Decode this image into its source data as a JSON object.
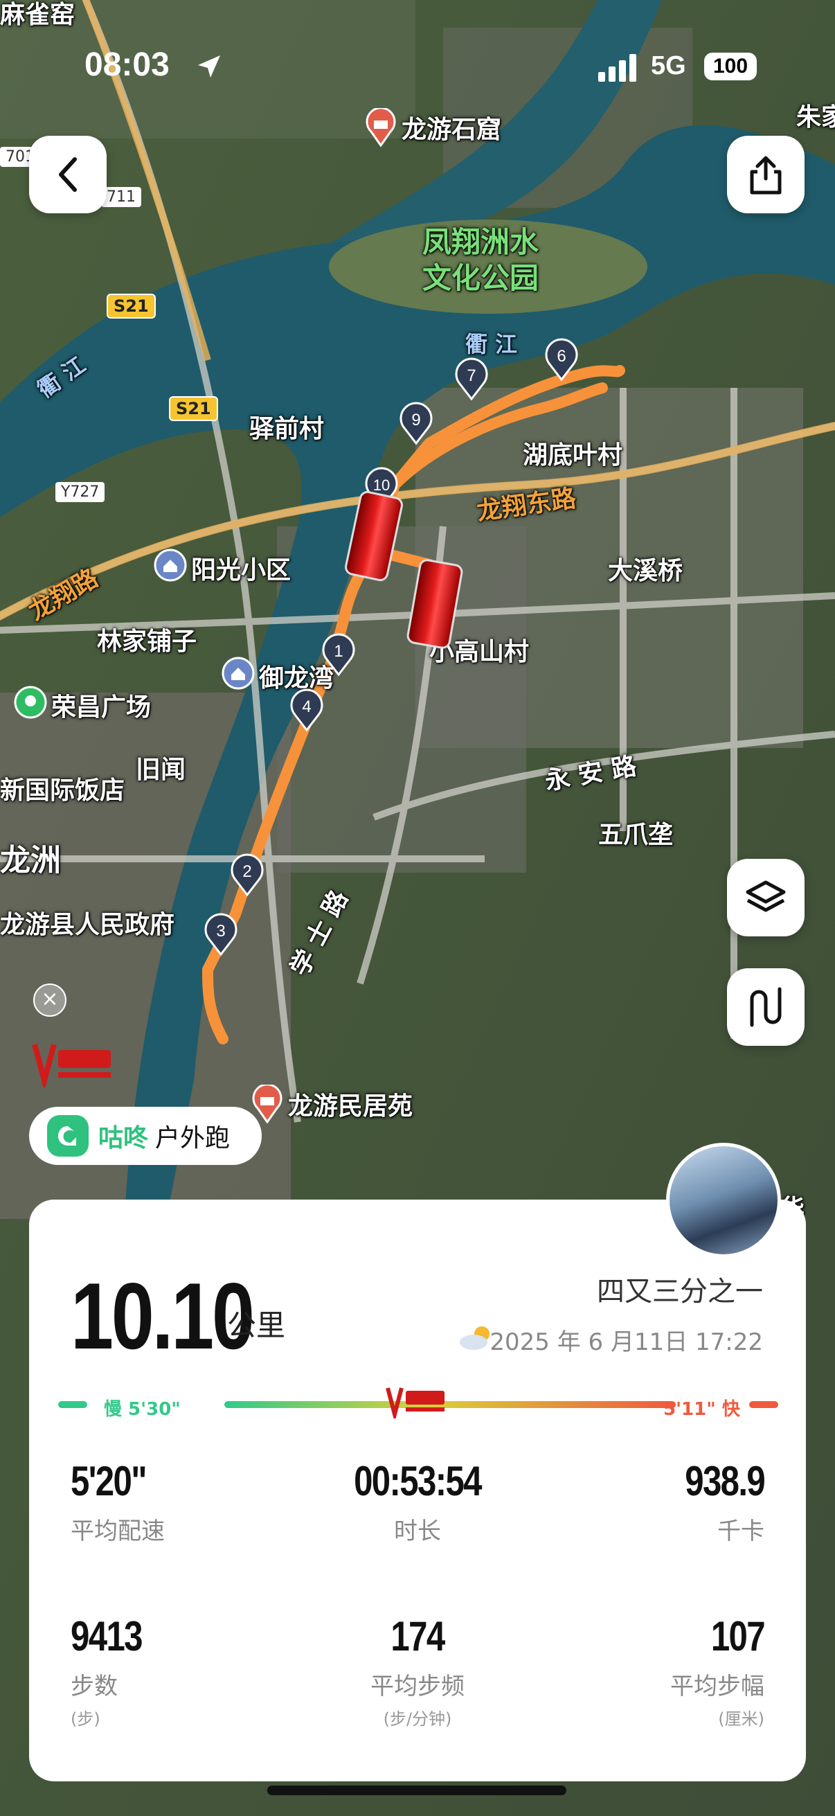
{
  "status_bar": {
    "time": "08:03",
    "network": "5G",
    "battery": "100"
  },
  "map": {
    "pois": [
      {
        "name": "龙游石窟"
      },
      {
        "name": "阳光小区"
      },
      {
        "name": "御龙湾"
      },
      {
        "name": "荣昌广场"
      },
      {
        "name": "龙游民居苑"
      }
    ],
    "labels": {
      "park": "凤翔洲水\n文化公园",
      "qujiang_east": "衢 江",
      "qujiang_west": "衢 江",
      "yiqian": "驿前村",
      "hudiyeye": "湖底叶村",
      "longxiang_east": "龙翔东路",
      "longxiang": "龙翔路",
      "daxiqiao": "大溪桥",
      "linjiapuzi": "林家铺子",
      "xiaogaoshan": "小高山村",
      "jiuwen": "旧闻",
      "xinguoji": "新国际饭店",
      "longzhou": "龙洲",
      "zhengfu": "龙游县人民政府",
      "yongan": "永 安 路",
      "wuzhaowa": "五爪垄",
      "xueshi": "学 士 路",
      "zhujia": "朱家",
      "maque": "麻雀窑",
      "hua": "华"
    },
    "shields": {
      "s21a": "S21",
      "s21b": "S21",
      "y727": "Y727",
      "r711": "711",
      "r701": "701"
    },
    "markers": [
      "1",
      "2",
      "3",
      "4",
      "6",
      "7",
      "9",
      "10"
    ],
    "route_color": "#f7923a"
  },
  "app_pill": {
    "brand": "咕咚",
    "label": "户外跑"
  },
  "summary": {
    "distance": "10.10",
    "distance_unit": "公里",
    "title": "四又三分之一",
    "datetime": "2025 年 6 月11日 17:22",
    "pace_bar": {
      "slow_label": "慢 5'30\"",
      "fast_label": "5'11\" 快"
    },
    "stats": [
      {
        "value": "5'20\"",
        "label": "平均配速",
        "unit": ""
      },
      {
        "value": "00:53:54",
        "label": "时长",
        "unit": ""
      },
      {
        "value": "938.9",
        "label": "千卡",
        "unit": ""
      },
      {
        "value": "9413",
        "label": "步数",
        "unit": "(步)"
      },
      {
        "value": "174",
        "label": "平均步频",
        "unit": "(步/分钟)"
      },
      {
        "value": "107",
        "label": "平均步幅",
        "unit": "(厘米)"
      }
    ]
  }
}
